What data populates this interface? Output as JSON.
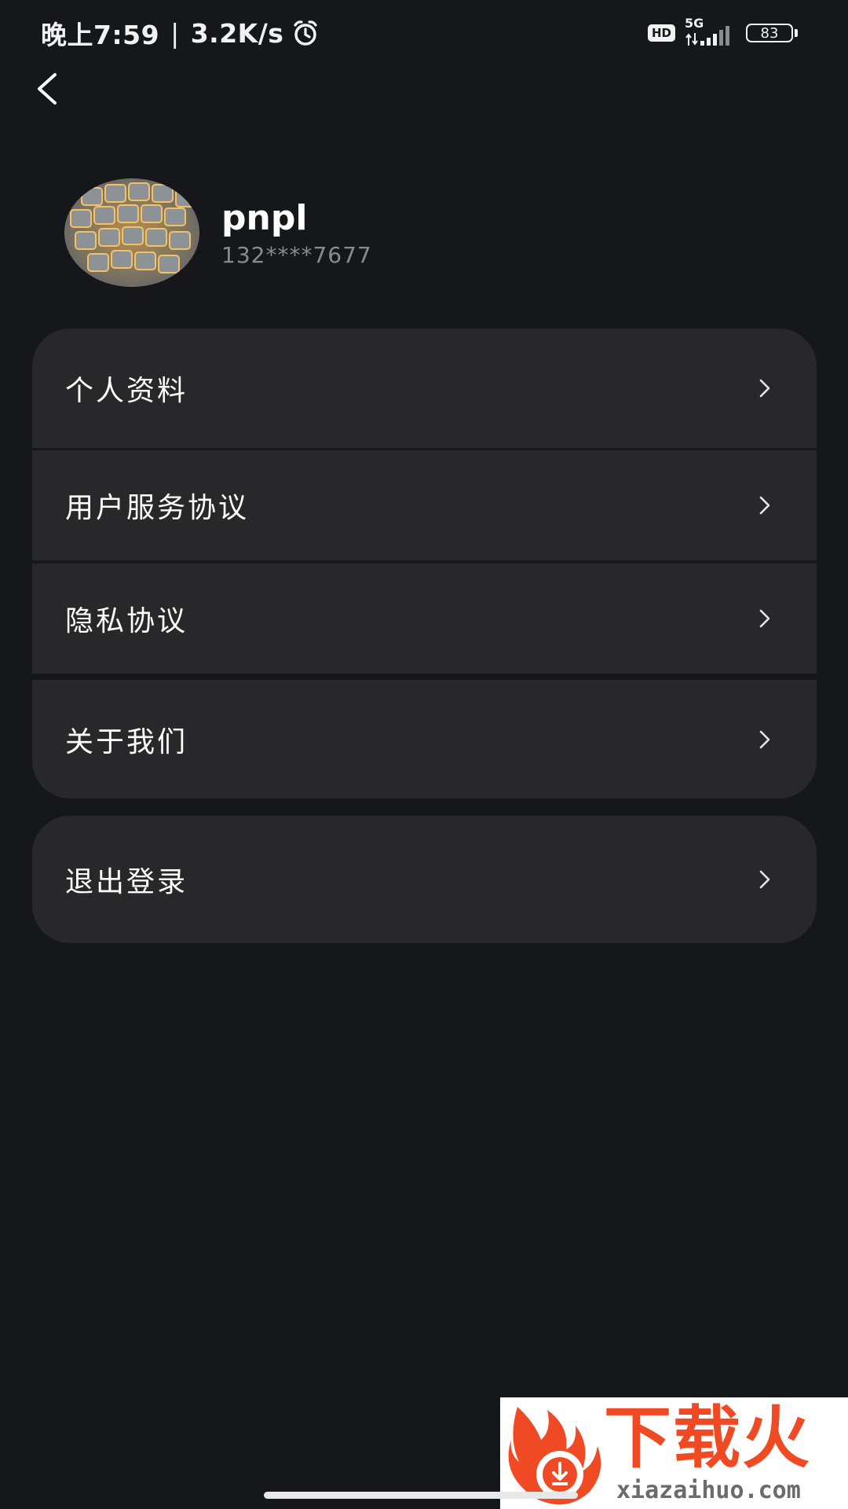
{
  "status_bar": {
    "time": "晚上7:59",
    "separator": "|",
    "net_speed": "3.2K/s",
    "hd_label": "HD",
    "network_type": "5G",
    "battery_level": "83",
    "icons": [
      "alarm-icon",
      "hd-icon",
      "signal-icon",
      "battery-icon"
    ]
  },
  "header": {
    "back_icon": "chevron-left-icon"
  },
  "profile": {
    "username": "pnpl",
    "phone": "132****7677",
    "avatar": "keyboard-photo"
  },
  "menu": {
    "items": [
      {
        "label": "个人资料"
      },
      {
        "label": "用户服务协议"
      },
      {
        "label": "隐私协议"
      },
      {
        "label": "关于我们"
      }
    ]
  },
  "logout": {
    "label": "退出登录"
  },
  "watermark": {
    "text": "下载火",
    "domain": "xiazaihuo.com"
  },
  "colors": {
    "background": "#16171b",
    "card": "#28282a",
    "text_primary": "#ffffff",
    "text_secondary": "#8a8b8f",
    "watermark_accent": "#f04a24"
  }
}
